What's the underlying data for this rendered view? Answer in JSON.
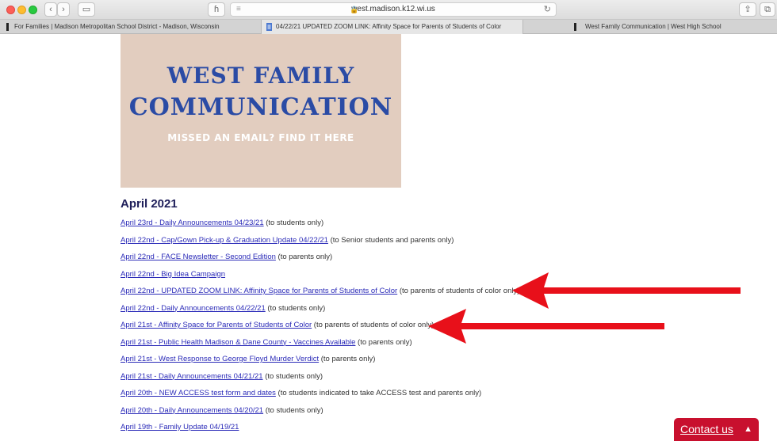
{
  "browser": {
    "url": "west.madison.k12.wi.us",
    "tabs": [
      {
        "title": "For Families | Madison Metropolitan School District - Madison, Wisconsin"
      },
      {
        "title": "04/22/21 UPDATED ZOOM LINK: Affinity Space for Parents of Students of Color"
      },
      {
        "title": "West Family Communication | West High School"
      }
    ]
  },
  "banner": {
    "line1": "WEST FAMILY",
    "line2": "COMMUNICATION",
    "subtitle": "MISSED AN EMAIL? FIND IT HERE"
  },
  "month_heading": "April 2021",
  "announcements": [
    {
      "link": "April 23rd - Daily Announcements 04/23/21",
      "note": " (to students only)"
    },
    {
      "link": "April 22nd - Cap/Gown Pick-up & Graduation Update 04/22/21",
      "note": " (to Senior students and parents only)"
    },
    {
      "link": "April 22nd - FACE Newsletter - Second Edition",
      "note": " (to parents only)"
    },
    {
      "link": "April 22nd - Big Idea Campaign",
      "note": ""
    },
    {
      "link": "April 22nd - UPDATED ZOOM LINK: Affinity Space for Parents of Students of Color",
      "note": " (to parents of students of color only)"
    },
    {
      "link": "April 22nd - Daily Announcements 04/22/21",
      "note": " (to students only)"
    },
    {
      "link": "April 21st - Affinity Space for Parents of Students of Color",
      "note": " (to parents of students of color only)"
    },
    {
      "link": "April 21st - Public Health Madison & Dane County - Vaccines Available",
      "note": " (to parents only)"
    },
    {
      "link": "April 21st - West Response to George Floyd Murder Verdict",
      "note": " (to parents only)"
    },
    {
      "link": "April 21st - Daily Announcements 04/21/21",
      "note": " (to students only)"
    },
    {
      "link": "April 20th - NEW ACCESS test form and dates",
      "note": " (to students indicated to take ACCESS test and parents only)"
    },
    {
      "link": "April 20th - Daily Announcements 04/20/21",
      "note": " (to students only)"
    },
    {
      "link": "April 19th - Family Update 04/19/21",
      "note": ""
    }
  ],
  "contact_button": "Contact us",
  "colors": {
    "banner_bg": "#e2cdbf",
    "banner_text": "#2a4ba5",
    "link": "#2b2bb8",
    "arrow": "#e8101a",
    "contact_bg": "#c8102e"
  }
}
